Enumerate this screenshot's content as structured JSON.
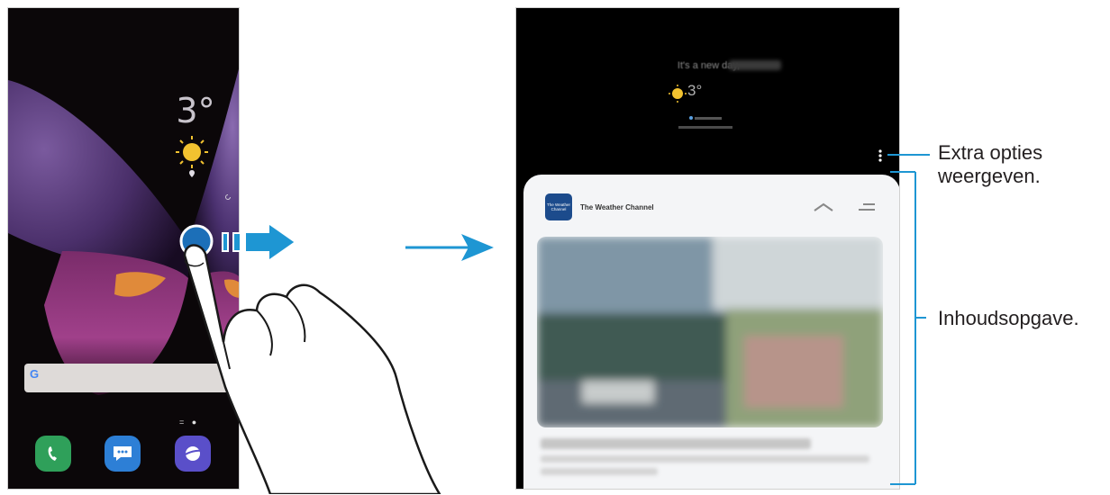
{
  "left_phone": {
    "lock_time": "3°",
    "dock_apps": [
      "phone-icon",
      "messages-icon",
      "internet-icon"
    ]
  },
  "right_phone": {
    "greeting": "It's a new day,",
    "temperature": "3°",
    "card_title": "The Weather Channel",
    "card_logo_text": "The Weather Channel"
  },
  "callouts": {
    "extra_options": "Extra opties weergeven.",
    "extra_options_line1": "Extra opties",
    "extra_options_line2": "weergeven.",
    "content": "Inhoudsopgave."
  },
  "colors": {
    "arrow": "#1e96d3",
    "card_bg": "#f4f5f7",
    "twc_blue": "#1c4b8c"
  }
}
